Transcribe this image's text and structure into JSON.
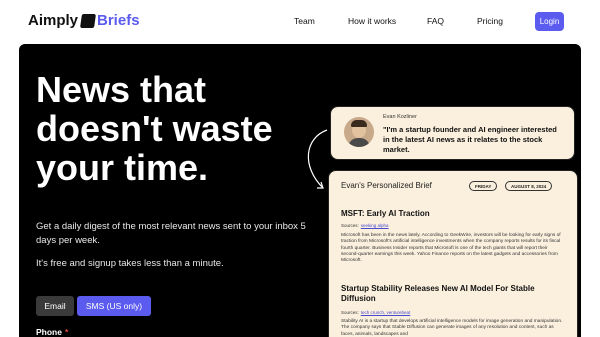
{
  "brand": {
    "name_part1": "Aimply",
    "name_part2": "Briefs"
  },
  "nav": {
    "team": "Team",
    "how": "How it works",
    "faq": "FAQ",
    "pricing": "Pricing",
    "login": "Login"
  },
  "hero": {
    "headline": "News that doesn't waste your time.",
    "sub1": "Get a daily digest of the most relevant news sent to your inbox 5 days per week.",
    "sub2": "It's free and signup takes less than a minute.",
    "toggle_email": "Email",
    "toggle_sms": "SMS (US only)",
    "phone_label": "Phone",
    "phone_required": "*"
  },
  "testimonial": {
    "name": "Evan Kozliner",
    "quote": "\"I'm a startup founder and AI engineer interested in the latest AI news as it relates to the stock market."
  },
  "brief": {
    "title": "Evan's Personalized Brief",
    "day": "FRIDAY",
    "date": "AUGUST 8, 2024",
    "articles": [
      {
        "title": "MSFT: Early AI Traction",
        "sources_label": "Sources:",
        "sources": "seeking alpha",
        "body": "Microsoft has been in the news lately. According to GeekWire, investors will be looking for early signs of traction from Microsoft's artificial intelligence investments when the company reports results for its fiscal fourth quarter. Business Insider reports that Microsoft is one of the tech giants that will report their second-quarter earnings this week. Yahoo Finance reports on the latest gadgets and accessories from Microsoft."
      },
      {
        "title": "Startup Stability Releases New AI Model For Stable Diffusion",
        "sources_label": "Sources:",
        "sources": "tech crunch, venturebeat",
        "body": "Stability AI is a startup that develops artificial intelligence models for image generation and manipulation. The company says that Stable Diffusion can generate images of any resolution and content, such as faces, animals, landscapes and"
      }
    ]
  }
}
